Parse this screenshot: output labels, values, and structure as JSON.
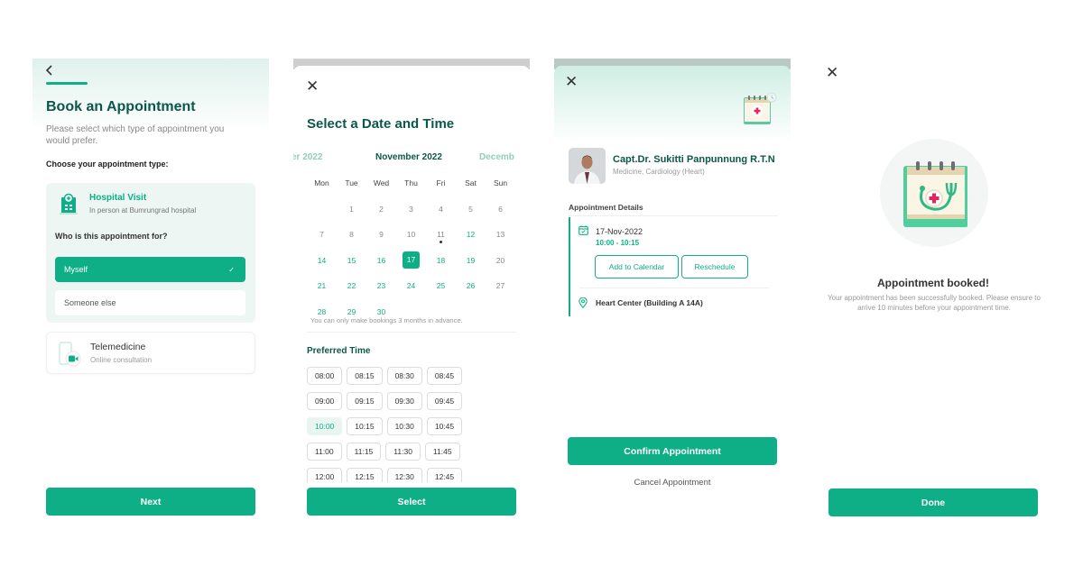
{
  "colors": {
    "primary": "#0eaf86",
    "title": "#0b5848",
    "accent_light": "#eef6f4"
  },
  "screen1": {
    "back_icon": "chevron-left-icon",
    "title": "Book an Appointment",
    "subtitle": "Please select which type of appointment you would prefer.",
    "choose_label": "Choose your appointment type:",
    "hospital_visit": {
      "title": "Hospital Visit",
      "subtitle": "In person at Bumrungrad hospital",
      "icon": "hospital-building-icon",
      "who_label": "Who is this appointment for?",
      "options": [
        {
          "label": "Myself",
          "selected": true
        },
        {
          "label": "Someone else",
          "selected": false
        }
      ],
      "check": "✓"
    },
    "telemedicine": {
      "title": "Telemedicine",
      "subtitle": "Online consultation",
      "icon": "video-call-icon"
    },
    "next_label": "Next"
  },
  "screen2": {
    "close": "✕",
    "title": "Select a Date and Time",
    "prev_month": "er 2022",
    "current_month": "November 2022",
    "next_month": "Decemb",
    "weekdays": [
      "Mon",
      "Tue",
      "Wed",
      "Thu",
      "Fri",
      "Sat",
      "Sun"
    ],
    "weeks": [
      [
        null,
        "1",
        "2",
        "3",
        "4",
        "5",
        "6"
      ],
      [
        "7",
        "8",
        "9",
        "10",
        "11",
        "12",
        "13"
      ],
      [
        "14",
        "15",
        "16",
        "17",
        "18",
        "19",
        "20"
      ],
      [
        "21",
        "22",
        "23",
        "24",
        "25",
        "26",
        "27"
      ],
      [
        "28",
        "29",
        "30",
        null,
        null,
        null,
        null
      ]
    ],
    "available_days": [
      "12",
      "14",
      "15",
      "16",
      "17",
      "18",
      "19",
      "21",
      "22",
      "23",
      "24",
      "25",
      "26",
      "28",
      "29",
      "30"
    ],
    "selected_day": "17",
    "today_day": "11",
    "note": "You can only make bookings 3 months in advance.",
    "preferred_time_label": "Preferred Time",
    "time_rows": [
      [
        "08:00",
        "08:15",
        "08:30",
        "08:45"
      ],
      [
        "09:00",
        "09:15",
        "09:30",
        "09:45"
      ],
      [
        "10:00",
        "10:15",
        "10:30",
        "10:45"
      ],
      [
        "11:00",
        "11:15",
        "11:30",
        "11:45"
      ],
      [
        "12:00",
        "12:15",
        "12:30",
        "12:45"
      ]
    ],
    "selected_time": "10:00",
    "select_label": "Select"
  },
  "screen3": {
    "close": "✕",
    "doctor_name": "Capt.Dr. Sukitti Panpunnung R.T.N",
    "doctor_specialty": "Medicine, Cardiology (Heart)",
    "details_label": "Appointment Details",
    "date": "17-Nov-2022",
    "time": "10:00 - 10:15",
    "add_calendar_label": "Add to Calendar",
    "reschedule_label": "Reschedule",
    "location": "Heart Center (Building A 14A)",
    "confirm_label": "Confirm Appointment",
    "cancel_label": "Cancel Appointment"
  },
  "screen4": {
    "close": "✕",
    "title": "Appointment booked!",
    "message": "Your appointment has been successfully booked. Please ensure to arrive 10 minutes before your appointment time.",
    "done_label": "Done"
  }
}
